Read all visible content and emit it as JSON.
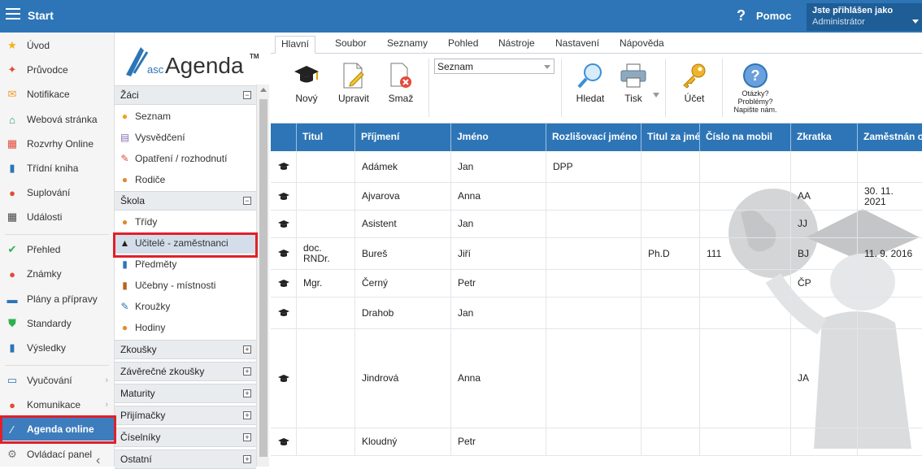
{
  "topbar": {
    "title": "Start",
    "help": "Pomoc",
    "user_label": "Jste přihlášen jako",
    "user_name": "Administrátor"
  },
  "leftnav": {
    "items": [
      {
        "label": "Úvod",
        "icon": "star-icon",
        "color": "#f2b21b"
      },
      {
        "label": "Průvodce",
        "icon": "wand-icon",
        "color": "#e34b3a"
      },
      {
        "label": "Notifikace",
        "icon": "envelope-icon",
        "color": "#f39c23"
      },
      {
        "label": "Webová stránka",
        "icon": "home-icon",
        "color": "#1f9b6e"
      },
      {
        "label": "Rozvrhy Online",
        "icon": "calendar-icon",
        "color": "#e34b3a"
      },
      {
        "label": "Třídní kniha",
        "icon": "book-icon",
        "color": "#2d75b6"
      },
      {
        "label": "Suplování",
        "icon": "person-icon",
        "color": "#e34b3a"
      },
      {
        "label": "Události",
        "icon": "calendar-grid-icon",
        "color": "#444"
      },
      {
        "label": "Přehled",
        "icon": "check-circle-icon",
        "color": "#2bb24c"
      },
      {
        "label": "Známky",
        "icon": "grade-icon",
        "color": "#e34b3a"
      },
      {
        "label": "Plány a přípravy",
        "icon": "briefcase-icon",
        "color": "#2d75b6"
      },
      {
        "label": "Standardy",
        "icon": "shield-icon",
        "color": "#2bb24c"
      },
      {
        "label": "Výsledky",
        "icon": "bar-chart-icon",
        "color": "#2d75b6"
      },
      {
        "label": "Vyučování",
        "icon": "open-book-icon",
        "color": "#2d75b6"
      },
      {
        "label": "Komunikace",
        "icon": "chat-icon",
        "color": "#e34b3a"
      },
      {
        "label": "Agenda online",
        "icon": "agenda-icon",
        "color": "#ffffff"
      },
      {
        "label": "Ovládací panel",
        "icon": "gear-icon",
        "color": "#777"
      }
    ]
  },
  "logo": {
    "prefix": "asc",
    "name": "Agenda",
    "tm": "TM"
  },
  "secondary": {
    "zaci": "Žáci",
    "zaci_items": [
      "Seznam",
      "Vysvědčení",
      "Opatření / rozhodnutí",
      "Rodiče"
    ],
    "skola": "Škola",
    "skola_items": [
      "Třídy",
      "Učitelé - zaměstnanci",
      "Předměty",
      "Učebny - místnosti",
      "Kroužky",
      "Hodiny"
    ],
    "collapsed": [
      "Zkoušky",
      "Závěrečné zkoušky",
      "Maturity",
      "Přijímačky",
      "Číselníky",
      "Ostatní"
    ]
  },
  "ribbon": {
    "tabs": [
      "Hlavní",
      "Soubor",
      "Seznamy",
      "Pohled",
      "Nástroje",
      "Nastavení",
      "Nápověda"
    ],
    "buttons": {
      "new": "Nový",
      "edit": "Upravit",
      "delete": "Smaž",
      "find": "Hledat",
      "print": "Tisk",
      "account": "Účet"
    },
    "select_value": "Seznam",
    "help_text": "Otázky? Problémy? Napište nám."
  },
  "grid": {
    "columns": [
      "Titul",
      "Příjmení",
      "Jméno",
      "Rozlišovací jméno",
      "Titul za jmé",
      "Číslo na mobil",
      "Zkratka",
      "Zaměstnán o"
    ],
    "rows": [
      {
        "titul": "",
        "prijmeni": "Adámek",
        "jmeno": "Jan",
        "rozlis": "DPP",
        "titul_za": "",
        "mobil": "",
        "zkratka": "",
        "zamestnan": ""
      },
      {
        "titul": "",
        "prijmeni": "Ajvarova",
        "jmeno": "Anna",
        "rozlis": "",
        "titul_za": "",
        "mobil": "",
        "zkratka": "AA",
        "zamestnan": "30. 11. 2021"
      },
      {
        "titul": "",
        "prijmeni": "Asistent",
        "jmeno": "Jan",
        "rozlis": "",
        "titul_za": "",
        "mobil": "",
        "zkratka": "JJ",
        "zamestnan": ""
      },
      {
        "titul": "doc. RNDr.",
        "prijmeni": "Bureš",
        "jmeno": "Jiří",
        "rozlis": "",
        "titul_za": "Ph.D",
        "mobil": "111",
        "zkratka": "BJ",
        "zamestnan": "11. 9. 2016"
      },
      {
        "titul": "Mgr.",
        "prijmeni": "Černý",
        "jmeno": "Petr",
        "rozlis": "",
        "titul_za": "",
        "mobil": "",
        "zkratka": "ČP",
        "zamestnan": ""
      },
      {
        "titul": "",
        "prijmeni": "Drahob",
        "jmeno": "Jan",
        "rozlis": "",
        "titul_za": "",
        "mobil": "",
        "zkratka": "",
        "zamestnan": ""
      },
      {
        "titul": "",
        "prijmeni": "Jindrová",
        "jmeno": "Anna",
        "rozlis": "",
        "titul_za": "",
        "mobil": "",
        "zkratka": "JA",
        "zamestnan": ""
      },
      {
        "titul": "",
        "prijmeni": "Kloudný",
        "jmeno": "Petr",
        "rozlis": "",
        "titul_za": "",
        "mobil": "",
        "zkratka": "",
        "zamestnan": ""
      }
    ]
  }
}
